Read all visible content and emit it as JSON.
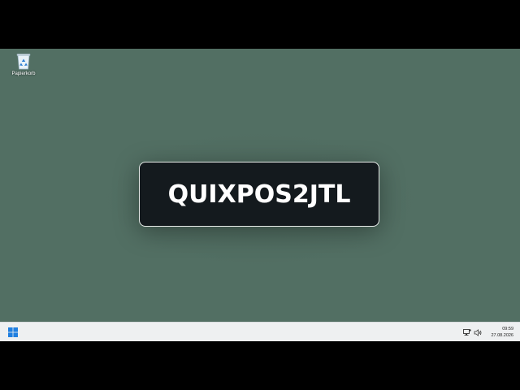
{
  "desktop": {
    "background_color": "#526f63",
    "icons": [
      {
        "label": "Papierkorb",
        "icon": "recycle-bin-icon"
      }
    ]
  },
  "overlay": {
    "text": "QUIXPOS2JTL",
    "background_color": "#141a1e",
    "border_color": "#e8ecea"
  },
  "taskbar": {
    "background_color": "#eef0f1",
    "start_icon": "windows-logo-icon",
    "tray_icons": [
      "network-icon",
      "volume-icon"
    ],
    "clock": {
      "time": "09:59",
      "date": "27.08.2026"
    }
  }
}
